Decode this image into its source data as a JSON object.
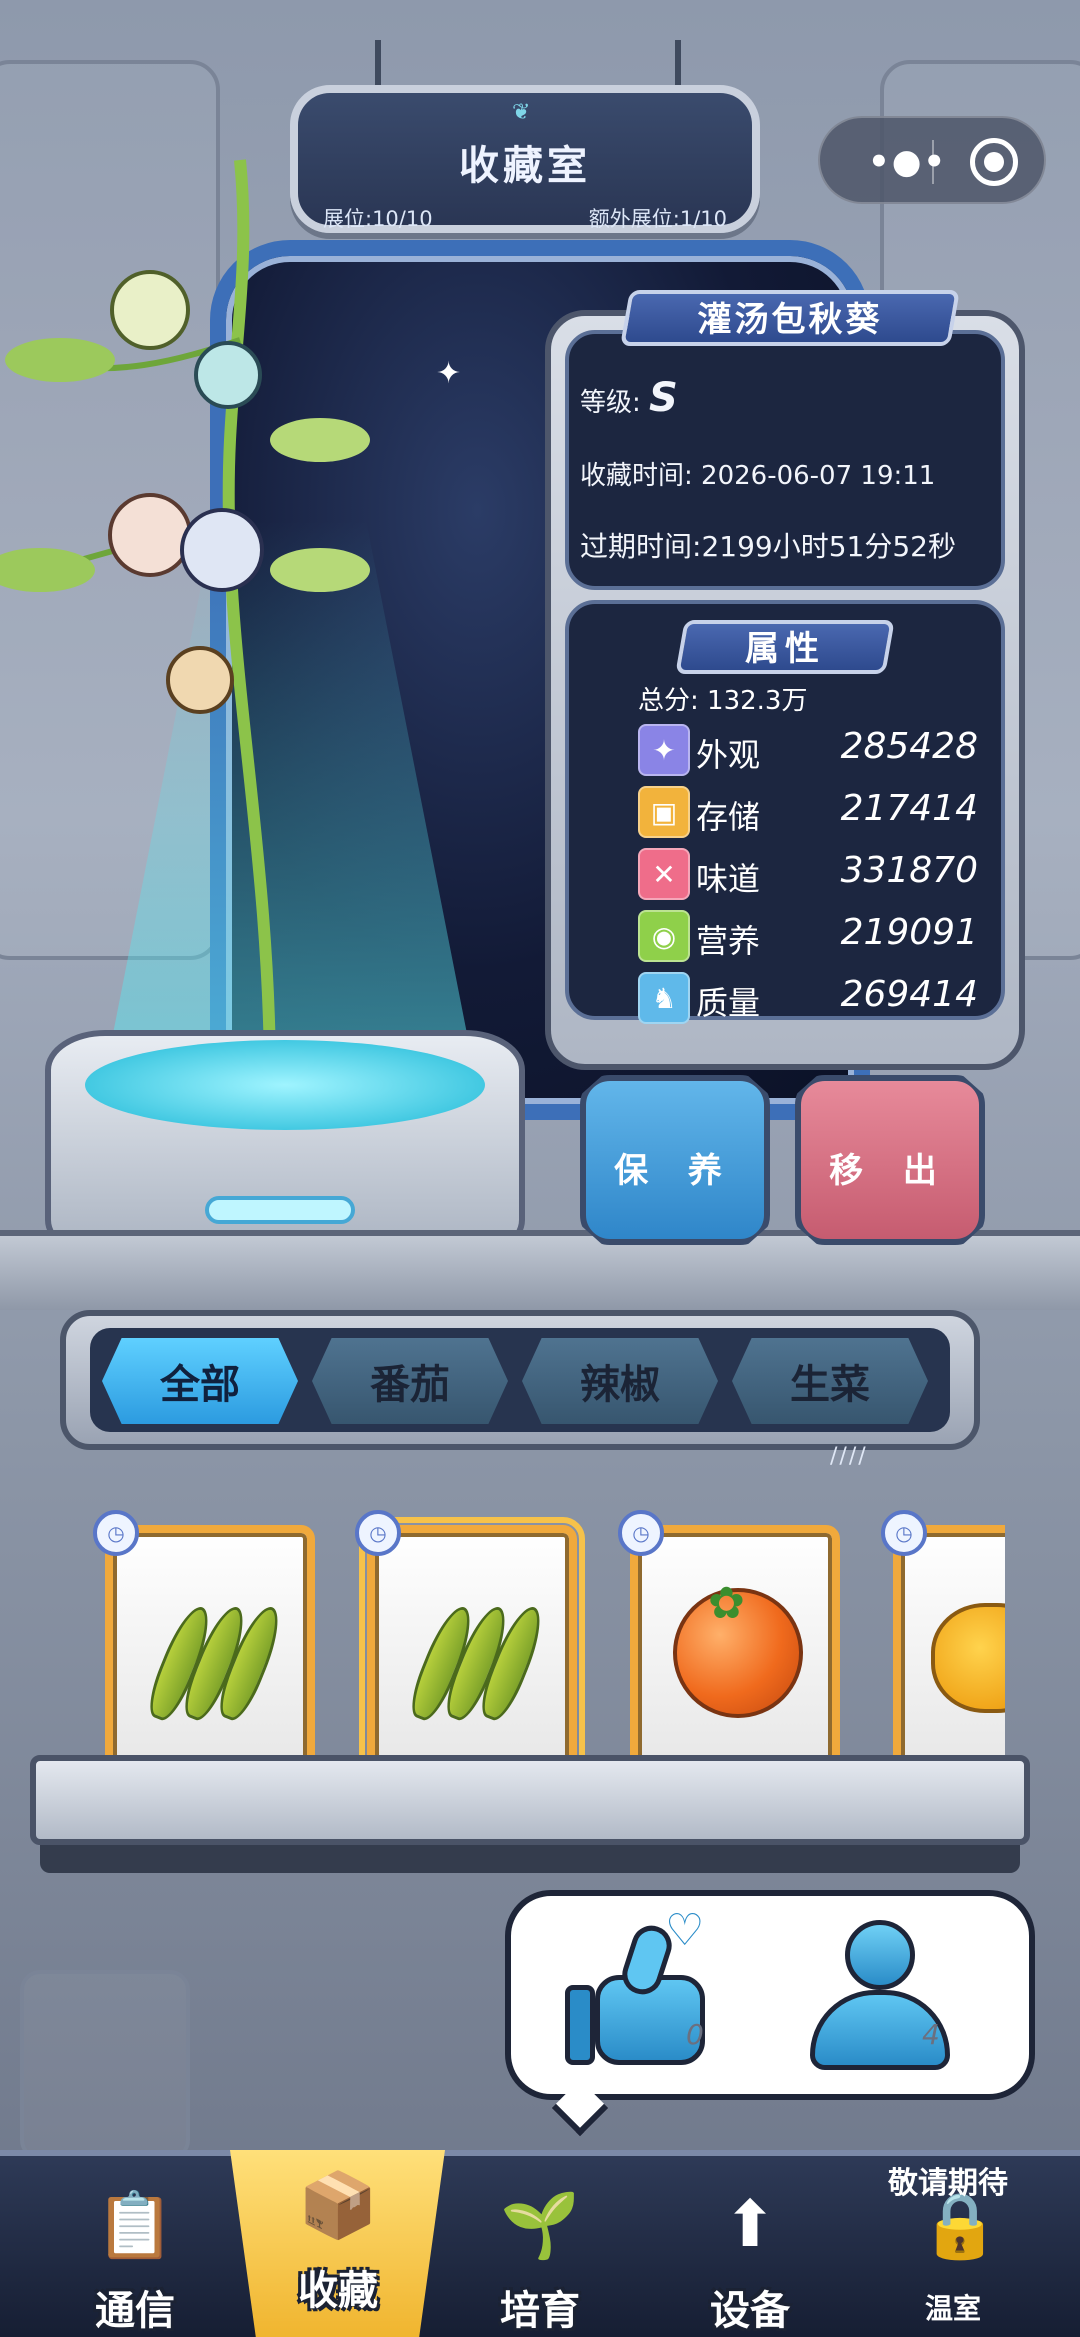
{
  "header": {
    "title": "收藏室",
    "slot_label": "展位:10/10",
    "extra_slot_label": "额外展位:1/10"
  },
  "capsule": {
    "menu_icon": "more-dots-icon",
    "close_icon": "target-close-icon"
  },
  "plant": {
    "name": "灌汤包秋葵",
    "grade_label": "等级:",
    "grade": "S",
    "collect_time_label": "收藏时间:",
    "collect_time": "2026-06-07 19:11",
    "expire_label": "过期时间:",
    "expire_time": "2199小时51分52秒"
  },
  "attributes": {
    "title": "属性",
    "total_label": "总分:",
    "total": "132.3万",
    "items": [
      {
        "icon": "sparkle-icon",
        "name": "外观",
        "value": "285428",
        "color": "#8a84e6"
      },
      {
        "icon": "box-icon",
        "name": "存储",
        "value": "217414",
        "color": "#f2b33c"
      },
      {
        "icon": "fork-knife-icon",
        "name": "味道",
        "value": "331870",
        "color": "#ef6d8a"
      },
      {
        "icon": "lemon-icon",
        "name": "营养",
        "value": "219091",
        "color": "#8fd04a"
      },
      {
        "icon": "muscle-icon",
        "name": "质量",
        "value": "269414",
        "color": "#5fb9ea"
      }
    ]
  },
  "actions": {
    "care": "保 养",
    "remove": "移 出"
  },
  "categories": {
    "tabs": [
      "全部",
      "番茄",
      "辣椒",
      "生菜"
    ],
    "active": "全部"
  },
  "collection": {
    "items": [
      {
        "kind": "okra",
        "name": "okra-icon"
      },
      {
        "kind": "okra",
        "name": "okra-icon"
      },
      {
        "kind": "tomato",
        "name": "persimmon-tomato-icon"
      },
      {
        "kind": "pumpkin",
        "name": "pumpkin-icon"
      }
    ]
  },
  "social": {
    "likes": "0",
    "visitors": "4"
  },
  "nav": {
    "items": [
      {
        "label": "通信",
        "icon": "clipboard-icon"
      },
      {
        "label": "收藏",
        "icon": "collection-box-icon"
      },
      {
        "label": "培育",
        "icon": "terrarium-icon"
      },
      {
        "label": "设备",
        "icon": "upgrade-device-icon"
      },
      {
        "label": "温室",
        "icon": "lock-icon"
      }
    ],
    "coming_soon": "敬请期待",
    "active": "收藏"
  }
}
